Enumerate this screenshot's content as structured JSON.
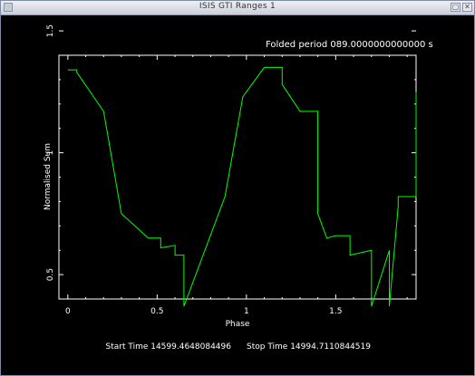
{
  "window": {
    "title": "ISIS GTI Ranges 1",
    "controls": {
      "maximize": "▢",
      "close": "✕"
    }
  },
  "chart_data": {
    "type": "line",
    "title": "Folded period 089.0000000000000 s",
    "xlabel": "Phase",
    "ylabel": "Normalised Sum",
    "xlim": [
      -0.05,
      1.95
    ],
    "ylim": [
      0.4,
      1.4
    ],
    "x_ticks": [
      0,
      0.5,
      1,
      1.5
    ],
    "x_tick_labels": [
      "0",
      "0.5",
      "1",
      "1.5"
    ],
    "y_ticks": [
      0.5,
      1,
      1.5
    ],
    "y_tick_labels": [
      "0.5",
      "1",
      "1.5"
    ],
    "color": "#00ff00",
    "series": [
      {
        "values": [
          [
            0.0,
            1.34
          ],
          [
            0.05,
            1.34
          ],
          [
            0.05,
            1.33
          ],
          [
            0.2,
            1.17
          ],
          [
            0.3,
            0.75
          ],
          [
            0.45,
            0.65
          ],
          [
            0.52,
            0.65
          ],
          [
            0.52,
            0.61
          ],
          [
            0.6,
            0.62
          ],
          [
            0.6,
            0.58
          ],
          [
            0.65,
            0.58
          ],
          [
            0.65,
            0.37
          ],
          [
            0.88,
            0.82
          ],
          [
            0.98,
            1.23
          ],
          [
            1.1,
            1.35
          ],
          [
            1.2,
            1.35
          ],
          [
            1.2,
            1.28
          ],
          [
            1.3,
            1.17
          ],
          [
            1.4,
            1.17
          ],
          [
            1.4,
            0.75
          ],
          [
            1.45,
            0.65
          ],
          [
            1.5,
            0.66
          ],
          [
            1.58,
            0.66
          ],
          [
            1.58,
            0.58
          ],
          [
            1.7,
            0.6
          ],
          [
            1.7,
            0.37
          ],
          [
            1.8,
            0.6
          ],
          [
            1.8,
            0.37
          ],
          [
            1.85,
            0.78
          ],
          [
            1.85,
            0.82
          ],
          [
            1.95,
            0.82
          ],
          [
            1.95,
            1.25
          ]
        ]
      }
    ]
  },
  "footer": {
    "start_time": "Start Time 14599.4648084496",
    "stop_time": "Stop Time 14994.7110844519"
  }
}
